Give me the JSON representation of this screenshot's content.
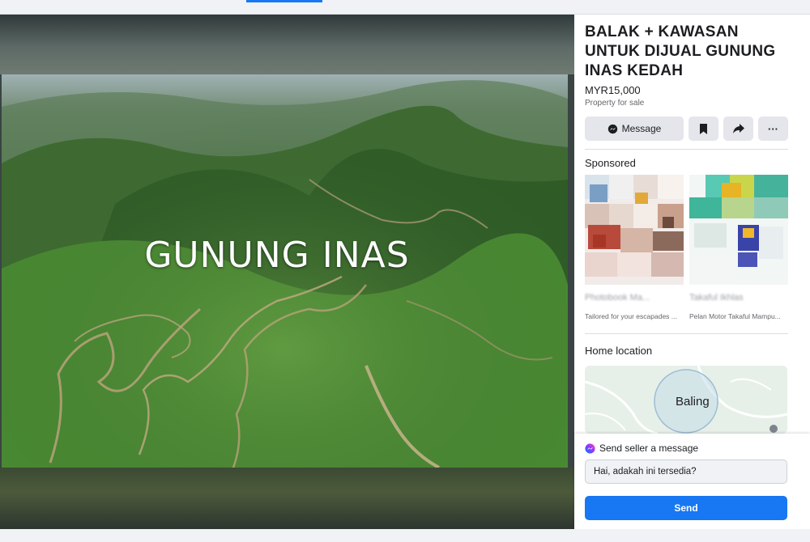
{
  "listing": {
    "title": "BALAK + KAWASAN UNTUK DIJUAL GUNUNG INAS KEDAH",
    "price": "MYR15,000",
    "category": "Property for sale",
    "photo_overlay_text": "GUNUNG INAS"
  },
  "actions": {
    "message_label": "Message",
    "message_icon": "messenger-icon",
    "save_icon": "bookmark-icon",
    "share_icon": "share-icon",
    "more_icon": "more-icon",
    "more_label": "···"
  },
  "sponsored": {
    "heading": "Sponsored",
    "items": [
      {
        "name": "Photobook Ma...",
        "description": "Tailored for your escapades ..."
      },
      {
        "name": "Takaful Ikhlas",
        "description": "Pelan Motor Takaful Mampu..."
      }
    ]
  },
  "home_location": {
    "heading": "Home location",
    "place": "Baling"
  },
  "send_message": {
    "heading": "Send seller a message",
    "input_value": "Hai, adakah ini tersedia?",
    "send_label": "Send"
  },
  "colors": {
    "accent": "#1877f2",
    "panel_bg": "#ffffff",
    "button_bg": "#e4e6eb"
  }
}
